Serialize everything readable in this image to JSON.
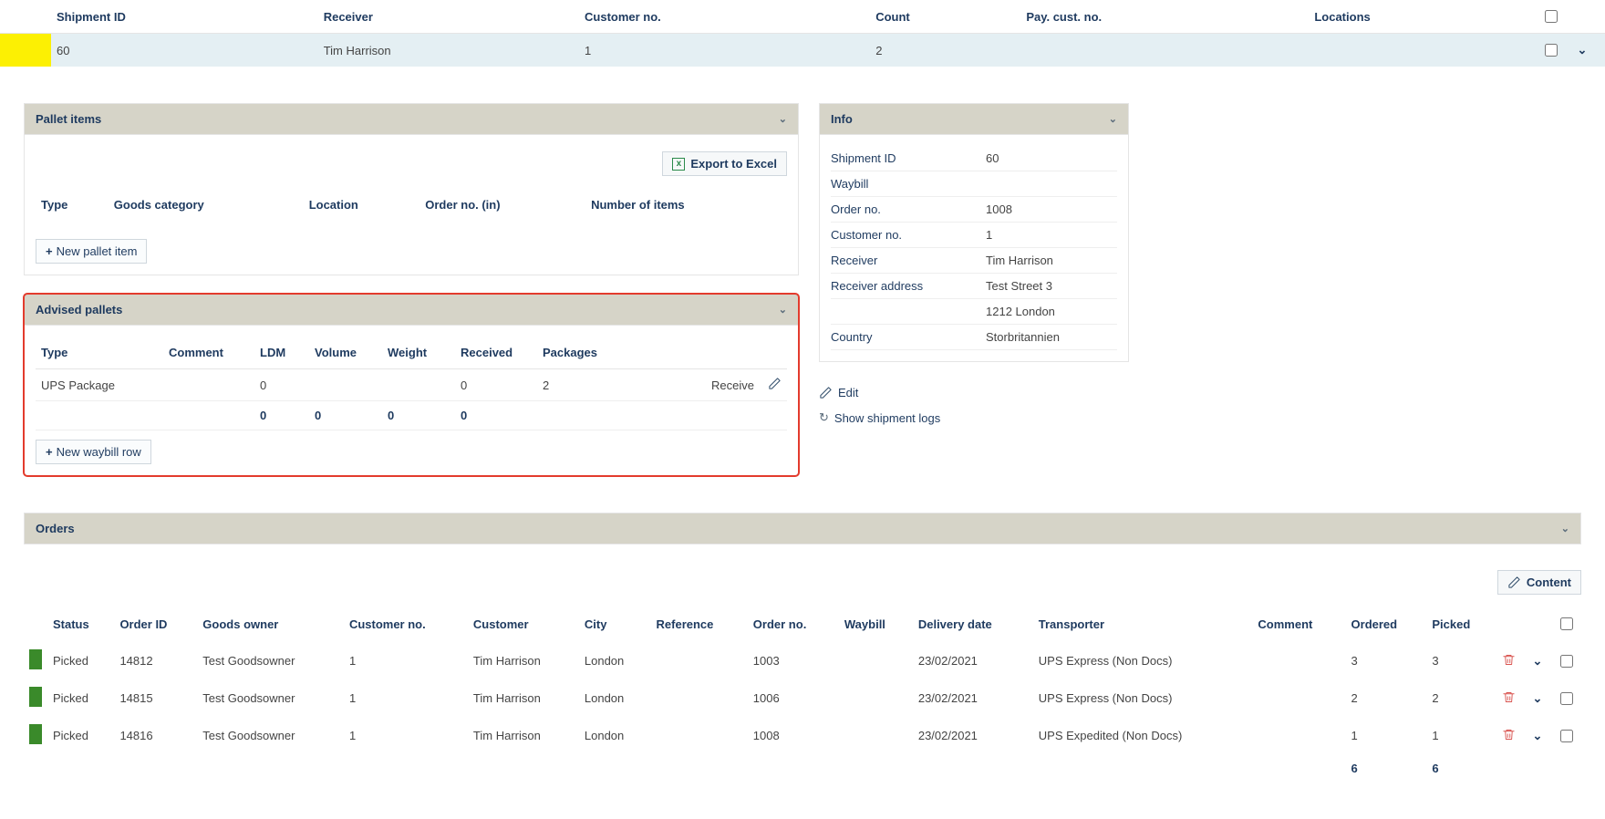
{
  "topTable": {
    "headers": [
      "Shipment ID",
      "Receiver",
      "Customer no.",
      "Count",
      "Pay. cust. no.",
      "Locations"
    ],
    "row": {
      "shipment_id": "60",
      "receiver": "Tim Harrison",
      "customer_no": "1",
      "count": "2",
      "pay_cust": "",
      "locations": ""
    }
  },
  "palletItems": {
    "title": "Pallet items",
    "export_label": "Export to Excel",
    "headers": [
      "Type",
      "Goods category",
      "Location",
      "Order no. (in)",
      "Number of items"
    ],
    "new_btn": "New pallet item"
  },
  "advisedPallets": {
    "title": "Advised pallets",
    "headers": [
      "Type",
      "Comment",
      "LDM",
      "Volume",
      "Weight",
      "Received",
      "Packages"
    ],
    "row": {
      "type": "UPS Package",
      "comment": "",
      "ldm": "0",
      "volume": "",
      "weight": "",
      "received": "0",
      "packages": "2",
      "action": "Receive"
    },
    "totals": {
      "ldm": "0",
      "volume": "0",
      "weight": "0",
      "received": "0"
    },
    "new_btn": "New waybill row"
  },
  "info": {
    "title": "Info",
    "rows": [
      {
        "label": "Shipment ID",
        "value": "60"
      },
      {
        "label": "Waybill",
        "value": ""
      },
      {
        "label": "Order no.",
        "value": "1008"
      },
      {
        "label": "Customer no.",
        "value": "1"
      },
      {
        "label": "Receiver",
        "value": "Tim Harrison"
      },
      {
        "label": "Receiver address",
        "value": "Test Street 3"
      },
      {
        "label": "",
        "value": "1212 London"
      },
      {
        "label": "Country",
        "value": "Storbritannien"
      }
    ],
    "edit_label": "Edit",
    "logs_label": "Show shipment logs"
  },
  "orders": {
    "title": "Orders",
    "content_label": "Content",
    "headers": [
      "Status",
      "Order ID",
      "Goods owner",
      "Customer no.",
      "Customer",
      "City",
      "Reference",
      "Order no.",
      "Waybill",
      "Delivery date",
      "Transporter",
      "Comment",
      "Ordered",
      "Picked"
    ],
    "rows": [
      {
        "status": "Picked",
        "order_id": "14812",
        "goods_owner": "Test Goodsowner",
        "customer_no": "1",
        "customer": "Tim Harrison",
        "city": "London",
        "reference": "",
        "order_no": "1003",
        "waybill": "",
        "delivery_date": "23/02/2021",
        "transporter": "UPS Express (Non Docs)",
        "comment": "",
        "ordered": "3",
        "picked": "3"
      },
      {
        "status": "Picked",
        "order_id": "14815",
        "goods_owner": "Test Goodsowner",
        "customer_no": "1",
        "customer": "Tim Harrison",
        "city": "London",
        "reference": "",
        "order_no": "1006",
        "waybill": "",
        "delivery_date": "23/02/2021",
        "transporter": "UPS Express (Non Docs)",
        "comment": "",
        "ordered": "2",
        "picked": "2"
      },
      {
        "status": "Picked",
        "order_id": "14816",
        "goods_owner": "Test Goodsowner",
        "customer_no": "1",
        "customer": "Tim Harrison",
        "city": "London",
        "reference": "",
        "order_no": "1008",
        "waybill": "",
        "delivery_date": "23/02/2021",
        "transporter": "UPS Expedited (Non Docs)",
        "comment": "",
        "ordered": "1",
        "picked": "1"
      }
    ],
    "totals": {
      "ordered": "6",
      "picked": "6"
    }
  }
}
